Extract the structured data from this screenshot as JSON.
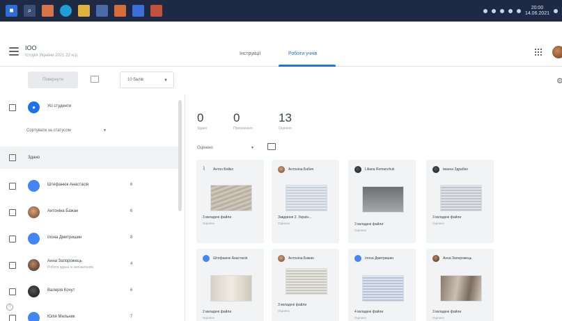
{
  "taskbar": {
    "clock_time": "20:00",
    "clock_date": "14.06.2021"
  },
  "header": {
    "course_title": "ІОО",
    "course_subtitle": "Історія України 2021 22 н.р.",
    "tabs": [
      {
        "label": "Інструкції",
        "active": false
      },
      {
        "label": "Роботи учнів",
        "active": true
      }
    ]
  },
  "toolbar": {
    "return_label": "Повернути",
    "points_select": "10 балів"
  },
  "students": {
    "all_label": "Усі студенти",
    "sort_label": "Сортувати за статусом",
    "assignment_section": "Здано",
    "list": [
      {
        "name": "Штефанюк Анастасія",
        "sub": "",
        "grade": "6",
        "avatar": "blue"
      },
      {
        "name": "Антоніна Бажан",
        "sub": "",
        "grade": "6",
        "avatar": "photo1"
      },
      {
        "name": "Ілона Дмитришин",
        "sub": "",
        "grade": "8",
        "avatar": "blue"
      },
      {
        "name": "Анна Запорожець",
        "sub": "Робота здана із запізненням",
        "grade": "4",
        "avatar": "photo2"
      },
      {
        "name": "Валерія Кочут",
        "sub": "",
        "grade": "6",
        "avatar": "photo3"
      },
      {
        "name": "Юлія Мельник",
        "sub": "",
        "grade": "7",
        "avatar": "blue"
      }
    ]
  },
  "stats": [
    {
      "value": "0",
      "label": "Здано"
    },
    {
      "value": "0",
      "label": "Призначено"
    },
    {
      "value": "13",
      "label": "Оцінено"
    }
  ],
  "filter": {
    "label": "Оцінено"
  },
  "cards": [
    {
      "name": "Антон Бойко",
      "files": "3 вкладені файли",
      "status": "Оцінено",
      "avatar": "clip",
      "thumb": "thumb-a"
    },
    {
      "name": "Антоніна Бабич",
      "files": "Завдання 2. Україн...",
      "status": "Оцінено",
      "avatar": "photo1",
      "thumb": "thumb-b"
    },
    {
      "name": "Liliana Romanchuk",
      "files": "3 вкладені файли",
      "status": "Оцінено",
      "avatar": "photo3",
      "thumb": "thumb-c"
    },
    {
      "name": "Іванна Здрабко",
      "files": "3 вкладені файли",
      "status": "Оцінено",
      "avatar": "photo3",
      "thumb": "thumb-d"
    },
    {
      "name": "Штефанюк Анастасія",
      "files": "2 вкладені файли",
      "status": "Оцінено",
      "avatar": "blue",
      "thumb": "thumb-e"
    },
    {
      "name": "Антоніна Бажан",
      "files": "3 вкладені файли",
      "status": "Оцінено",
      "avatar": "photo1",
      "thumb": "thumb-f"
    },
    {
      "name": "Ілона Дмитришин",
      "files": "4 вкладені файли",
      "status": "Оцінено",
      "avatar": "blue",
      "thumb": "thumb-g"
    },
    {
      "name": "Анна Запорожець",
      "files": "3 вкладені файли",
      "status": "Оцінено",
      "avatar": "photo2",
      "thumb": "thumb-h"
    }
  ]
}
